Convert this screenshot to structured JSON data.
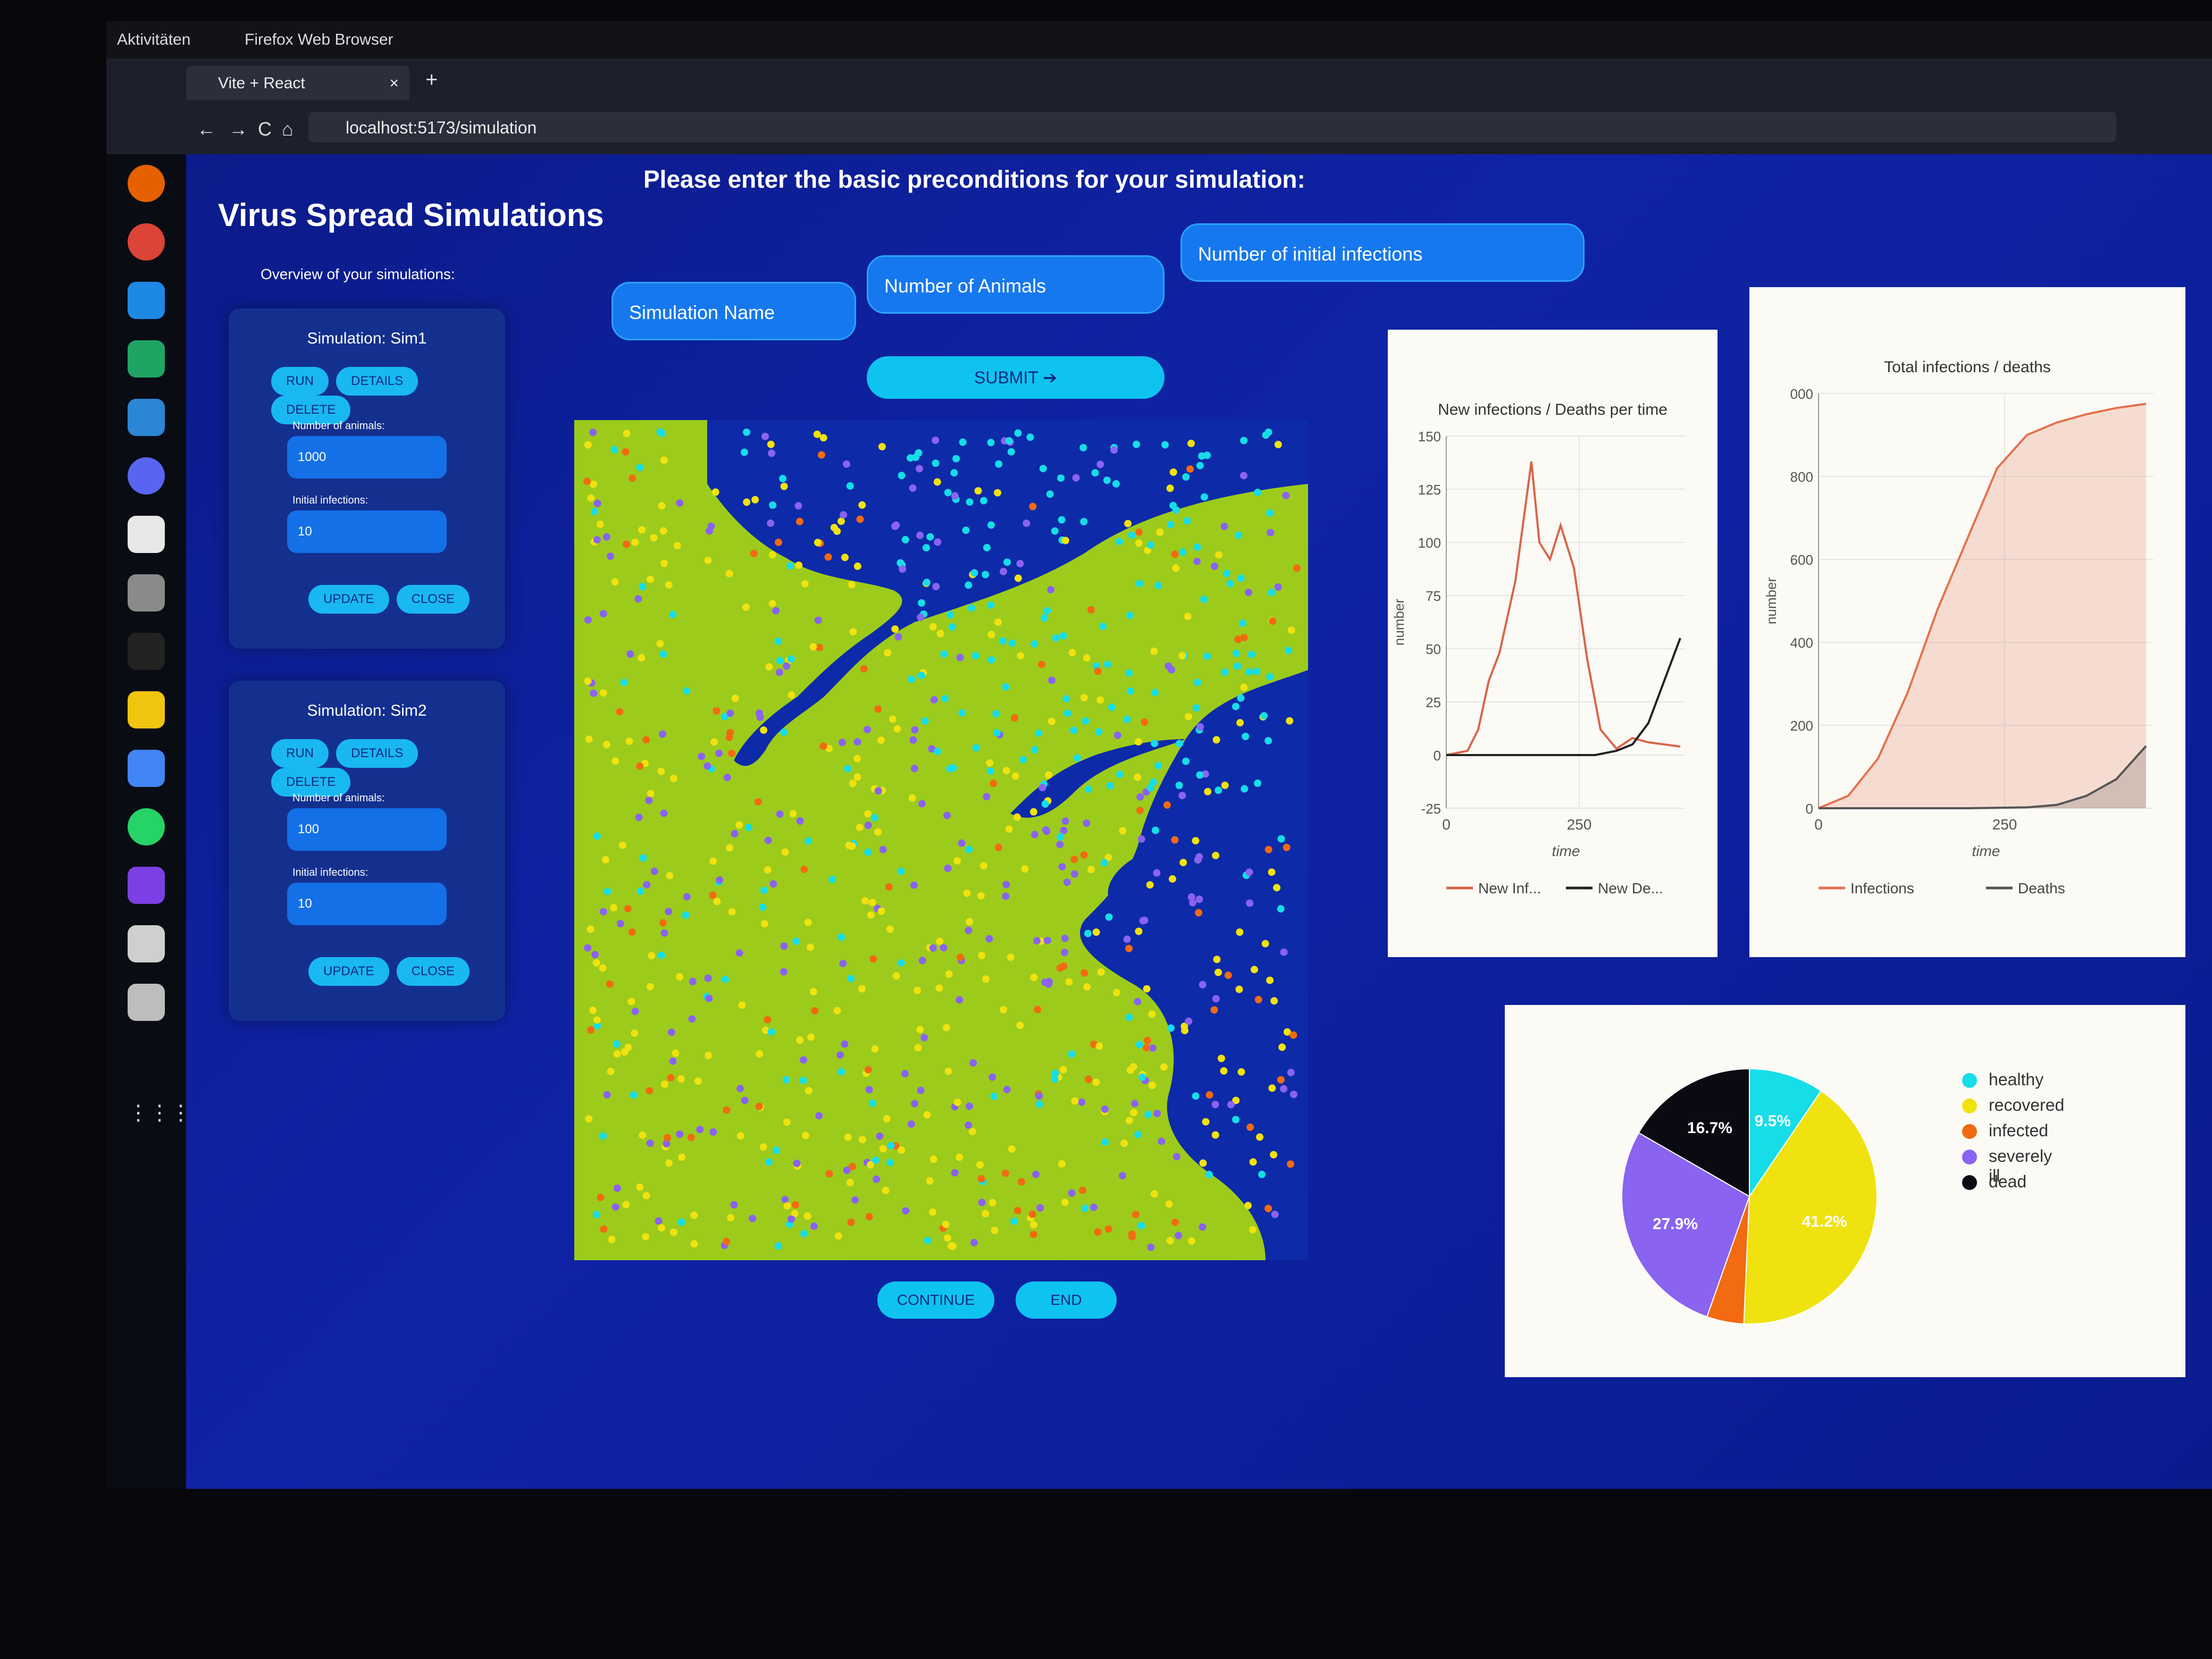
{
  "system_bar": {
    "activities": "Aktivitäten",
    "app_name": "Firefox Web Browser"
  },
  "browser": {
    "tab_title": "Vite + React",
    "tab_close": "×",
    "new_tab": "+",
    "url": "localhost:5173/simulation",
    "nav": {
      "back": "←",
      "forward": "→",
      "reload": "C",
      "home": "⌂"
    }
  },
  "sidebar": {
    "title": "Virus Spread Simulations",
    "overview_label": "Overview of your simulations:",
    "simulations": [
      {
        "title": "Simulation: Sim1",
        "run": "RUN",
        "details": "DETAILS",
        "delete": "DELETE",
        "animals_label": "Number of animals:",
        "animals_value": "1000",
        "infections_label": "Initial infections:",
        "infections_value": "10",
        "update": "UPDATE",
        "close": "CLOSE"
      },
      {
        "title": "Simulation: Sim2",
        "run": "RUN",
        "details": "DETAILS",
        "delete": "DELETE",
        "animals_label": "Number of animals:",
        "animals_value": "100",
        "infections_label": "Initial infections:",
        "infections_value": "10",
        "update": "UPDATE",
        "close": "CLOSE"
      }
    ]
  },
  "form": {
    "prompt": "Please enter the basic preconditions for your simulation:",
    "sim_name_placeholder": "Simulation Name",
    "animals_placeholder": "Number of Animals",
    "infections_placeholder": "Number of initial infections",
    "submit": "SUBMIT ➔"
  },
  "controls": {
    "continue": "CONTINUE",
    "end": "END"
  },
  "colors": {
    "healthy": "#16dde8",
    "recovered": "#f0e20e",
    "infected": "#f26a12",
    "severely_ill": "#8a63f0",
    "dead": "#0a0a12",
    "land": "#9ccb1c",
    "water": "#0d2aa8"
  },
  "chart_data": [
    {
      "type": "line",
      "title": "New infections / Deaths per time",
      "xlabel": "time",
      "ylabel": "number",
      "xlim": [
        0,
        450
      ],
      "ylim": [
        -25,
        150
      ],
      "xticks": [
        0,
        250
      ],
      "yticks": [
        -25,
        0,
        25,
        50,
        75,
        100,
        125,
        150
      ],
      "legend_position": "bottom",
      "grid": true,
      "series": [
        {
          "name": "New Inf...",
          "color": "#d8664a",
          "x": [
            0,
            40,
            60,
            80,
            100,
            130,
            160,
            175,
            195,
            215,
            240,
            265,
            290,
            320,
            350,
            380,
            410,
            440
          ],
          "y": [
            0,
            2,
            12,
            35,
            48,
            82,
            138,
            100,
            92,
            108,
            88,
            45,
            12,
            3,
            8,
            6,
            5,
            4
          ]
        },
        {
          "name": "New De...",
          "color": "#222222",
          "x": [
            0,
            100,
            200,
            280,
            320,
            350,
            380,
            410,
            440
          ],
          "y": [
            0,
            0,
            0,
            0,
            2,
            5,
            15,
            35,
            55
          ]
        }
      ]
    },
    {
      "type": "area",
      "title": "Total infections / deaths",
      "xlabel": "time",
      "ylabel": "number",
      "xlim": [
        0,
        450
      ],
      "ylim": [
        0,
        1000
      ],
      "xticks": [
        0,
        250
      ],
      "yticks": [
        0,
        200,
        400,
        600,
        800,
        "000"
      ],
      "legend_position": "bottom",
      "grid": true,
      "series": [
        {
          "name": "Infections",
          "color": "#e5714e",
          "x": [
            0,
            40,
            80,
            120,
            160,
            200,
            240,
            280,
            320,
            360,
            400,
            440
          ],
          "y": [
            0,
            30,
            120,
            280,
            480,
            650,
            820,
            900,
            930,
            950,
            965,
            975
          ]
        },
        {
          "name": "Deaths",
          "color": "#555555",
          "x": [
            0,
            200,
            280,
            320,
            360,
            400,
            440
          ],
          "y": [
            0,
            0,
            2,
            8,
            30,
            70,
            150
          ]
        }
      ]
    },
    {
      "type": "pie",
      "categories": [
        "healthy",
        "recovered",
        "infected",
        "severely ill",
        "dead"
      ],
      "values": [
        9.5,
        41.2,
        4.7,
        27.9,
        16.7
      ],
      "labels": [
        "9.5%",
        "41.2%",
        "",
        "27.9%",
        "16.7%"
      ],
      "legend_position": "right"
    }
  ]
}
